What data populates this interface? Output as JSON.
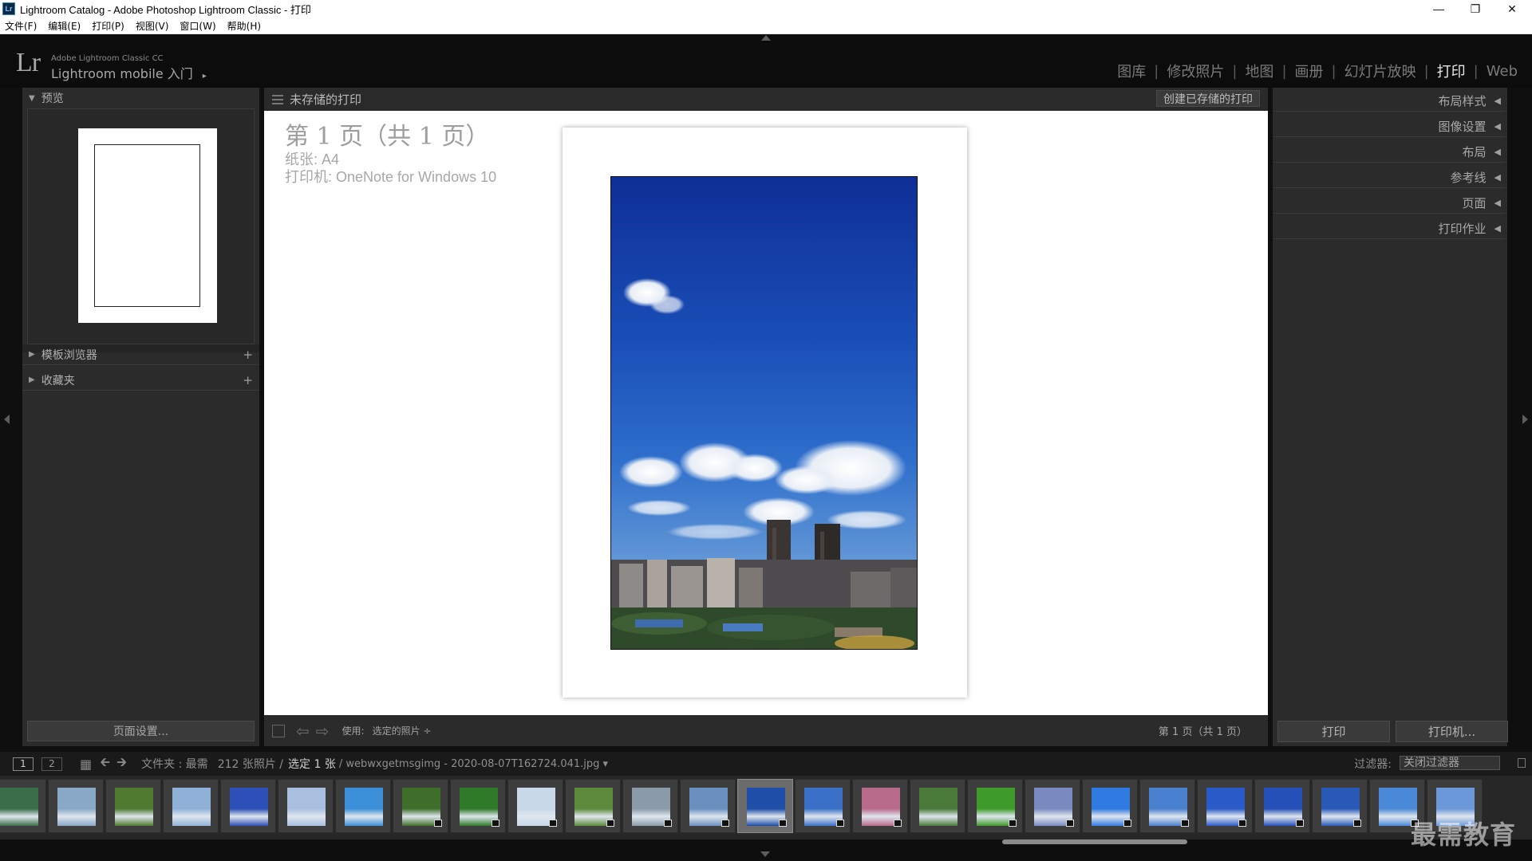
{
  "window": {
    "title": "Lightroom Catalog - Adobe Photoshop Lightroom Classic - 打印",
    "app_icon": "Lr"
  },
  "menu": [
    "文件(F)",
    "编辑(E)",
    "打印(P)",
    "视图(V)",
    "窗口(W)",
    "帮助(H)"
  ],
  "identity": {
    "logo": "Lr",
    "small": "Adobe Lightroom Classic CC",
    "big": "Lightroom mobile 入门",
    "arrow": "▸"
  },
  "modules": [
    {
      "label": "图库"
    },
    {
      "label": "修改照片"
    },
    {
      "label": "地图"
    },
    {
      "label": "画册"
    },
    {
      "label": "幻灯片放映"
    },
    {
      "label": "打印",
      "active": true
    },
    {
      "label": "Web"
    }
  ],
  "module_separator": "|",
  "left_panel": {
    "preview": "预览",
    "template_browser": "模板浏览器",
    "collections": "收藏夹",
    "plus": "+",
    "page_setup": "页面设置..."
  },
  "center": {
    "title": "未存储的打印",
    "save_button": "创建已存储的打印",
    "page_line": "第 1 页（共 1 页）",
    "paper_line": "纸张: A4",
    "printer_line": "打印机: OneNote for Windows 10",
    "use_label": "使用:",
    "use_value": "选定的照片 ÷",
    "page_count": "第 1 页（共 1 页）"
  },
  "right_panel": {
    "sections": [
      "布局样式",
      "图像设置",
      "布局",
      "参考线",
      "页面",
      "打印作业"
    ],
    "print_button": "打印",
    "printer_button": "打印机..."
  },
  "filmstrip_bar": {
    "monitor1": "1",
    "monitor2": "2",
    "source": "文件夹 : 最需",
    "count": "212 张照片 /",
    "selected": "选定 1 张",
    "filename": "/ webwxgetmsgimg - 2020-08-07T162724.041.jpg ▾",
    "filter_label": "过滤器:",
    "filter_value": "关闭过滤器"
  },
  "thumbnails": [
    {
      "color": "#3a6e4a",
      "badge": false
    },
    {
      "color": "#8aa8c8",
      "badge": false
    },
    {
      "color": "#4f7a30",
      "badge": false
    },
    {
      "color": "#8fb1d8",
      "badge": false
    },
    {
      "color": "#2d4fb8",
      "badge": false
    },
    {
      "color": "#a8bfe0",
      "badge": false
    },
    {
      "color": "#3a8fd8",
      "badge": false
    },
    {
      "color": "#3f6e2a",
      "badge": true
    },
    {
      "color": "#2f7a28",
      "badge": true
    },
    {
      "color": "#c8d8e8",
      "badge": true
    },
    {
      "color": "#5a8a3a",
      "badge": true
    },
    {
      "color": "#8a9aa8",
      "badge": true
    },
    {
      "color": "#6a90c0",
      "badge": true
    },
    {
      "color": "#1e4ea8",
      "badge": true,
      "selected": true
    },
    {
      "color": "#3a70c8",
      "badge": true
    },
    {
      "color": "#b86a8a",
      "badge": true
    },
    {
      "color": "#4a7a3a",
      "badge": false
    },
    {
      "color": "#3e9a2a",
      "badge": true
    },
    {
      "color": "#7a8ac0",
      "badge": true
    },
    {
      "color": "#2f7ae0",
      "badge": true
    },
    {
      "color": "#4a80d0",
      "badge": true
    },
    {
      "color": "#2a5ac8",
      "badge": true
    },
    {
      "color": "#2550b8",
      "badge": true
    },
    {
      "color": "#2a5ab8",
      "badge": true
    },
    {
      "color": "#4a88d8",
      "badge": true
    },
    {
      "color": "#6a98d8",
      "badge": false
    }
  ],
  "watermark": "最需教育"
}
